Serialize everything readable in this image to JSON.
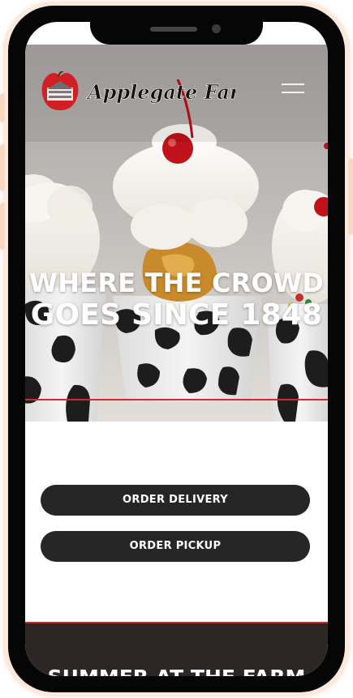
{
  "brand": {
    "name": "Applegate Farm",
    "colors": {
      "accent_red": "#d8262e",
      "button_dark": "#262626",
      "section_dark": "#2c2624",
      "text_light": "#ffffff"
    }
  },
  "header": {
    "menu_icon": "hamburger-menu-icon"
  },
  "hero": {
    "headline_line1": "WHERE THE CROWD",
    "headline_line2": "GOES SINCE 1848"
  },
  "actions": {
    "order_delivery": "ORDER DELIVERY",
    "order_pickup": "ORDER PICKUP"
  },
  "next_section": {
    "title": "SUMMER AT THE FARM"
  }
}
